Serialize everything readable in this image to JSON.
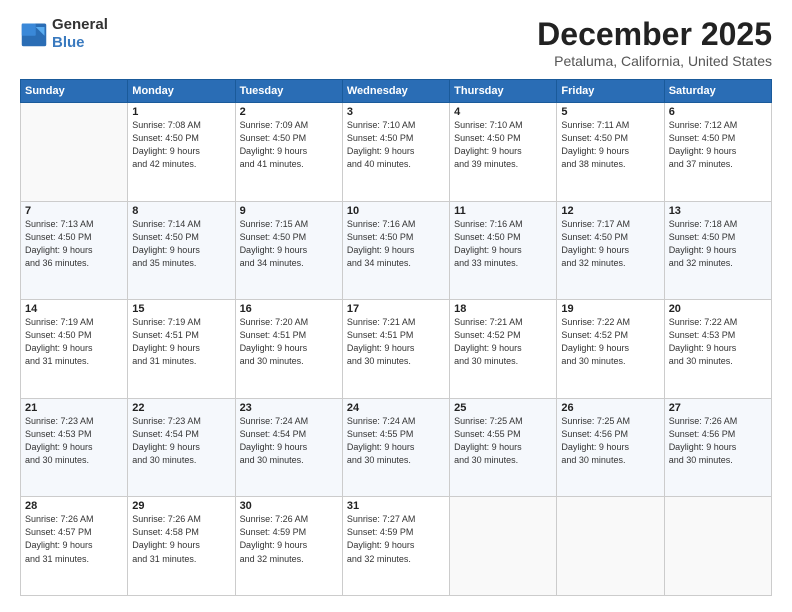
{
  "header": {
    "logo_line1": "General",
    "logo_line2": "Blue",
    "month_title": "December 2025",
    "location": "Petaluma, California, United States"
  },
  "weekdays": [
    "Sunday",
    "Monday",
    "Tuesday",
    "Wednesday",
    "Thursday",
    "Friday",
    "Saturday"
  ],
  "weeks": [
    [
      {
        "day": "",
        "sunrise": "",
        "sunset": "",
        "daylight": ""
      },
      {
        "day": "1",
        "sunrise": "7:08 AM",
        "sunset": "4:50 PM",
        "daylight": "9 hours and 42 minutes."
      },
      {
        "day": "2",
        "sunrise": "7:09 AM",
        "sunset": "4:50 PM",
        "daylight": "9 hours and 41 minutes."
      },
      {
        "day": "3",
        "sunrise": "7:10 AM",
        "sunset": "4:50 PM",
        "daylight": "9 hours and 40 minutes."
      },
      {
        "day": "4",
        "sunrise": "7:10 AM",
        "sunset": "4:50 PM",
        "daylight": "9 hours and 39 minutes."
      },
      {
        "day": "5",
        "sunrise": "7:11 AM",
        "sunset": "4:50 PM",
        "daylight": "9 hours and 38 minutes."
      },
      {
        "day": "6",
        "sunrise": "7:12 AM",
        "sunset": "4:50 PM",
        "daylight": "9 hours and 37 minutes."
      }
    ],
    [
      {
        "day": "7",
        "sunrise": "7:13 AM",
        "sunset": "4:50 PM",
        "daylight": "9 hours and 36 minutes."
      },
      {
        "day": "8",
        "sunrise": "7:14 AM",
        "sunset": "4:50 PM",
        "daylight": "9 hours and 35 minutes."
      },
      {
        "day": "9",
        "sunrise": "7:15 AM",
        "sunset": "4:50 PM",
        "daylight": "9 hours and 34 minutes."
      },
      {
        "day": "10",
        "sunrise": "7:16 AM",
        "sunset": "4:50 PM",
        "daylight": "9 hours and 34 minutes."
      },
      {
        "day": "11",
        "sunrise": "7:16 AM",
        "sunset": "4:50 PM",
        "daylight": "9 hours and 33 minutes."
      },
      {
        "day": "12",
        "sunrise": "7:17 AM",
        "sunset": "4:50 PM",
        "daylight": "9 hours and 32 minutes."
      },
      {
        "day": "13",
        "sunrise": "7:18 AM",
        "sunset": "4:50 PM",
        "daylight": "9 hours and 32 minutes."
      }
    ],
    [
      {
        "day": "14",
        "sunrise": "7:19 AM",
        "sunset": "4:50 PM",
        "daylight": "9 hours and 31 minutes."
      },
      {
        "day": "15",
        "sunrise": "7:19 AM",
        "sunset": "4:51 PM",
        "daylight": "9 hours and 31 minutes."
      },
      {
        "day": "16",
        "sunrise": "7:20 AM",
        "sunset": "4:51 PM",
        "daylight": "9 hours and 30 minutes."
      },
      {
        "day": "17",
        "sunrise": "7:21 AM",
        "sunset": "4:51 PM",
        "daylight": "9 hours and 30 minutes."
      },
      {
        "day": "18",
        "sunrise": "7:21 AM",
        "sunset": "4:52 PM",
        "daylight": "9 hours and 30 minutes."
      },
      {
        "day": "19",
        "sunrise": "7:22 AM",
        "sunset": "4:52 PM",
        "daylight": "9 hours and 30 minutes."
      },
      {
        "day": "20",
        "sunrise": "7:22 AM",
        "sunset": "4:53 PM",
        "daylight": "9 hours and 30 minutes."
      }
    ],
    [
      {
        "day": "21",
        "sunrise": "7:23 AM",
        "sunset": "4:53 PM",
        "daylight": "9 hours and 30 minutes."
      },
      {
        "day": "22",
        "sunrise": "7:23 AM",
        "sunset": "4:54 PM",
        "daylight": "9 hours and 30 minutes."
      },
      {
        "day": "23",
        "sunrise": "7:24 AM",
        "sunset": "4:54 PM",
        "daylight": "9 hours and 30 minutes."
      },
      {
        "day": "24",
        "sunrise": "7:24 AM",
        "sunset": "4:55 PM",
        "daylight": "9 hours and 30 minutes."
      },
      {
        "day": "25",
        "sunrise": "7:25 AM",
        "sunset": "4:55 PM",
        "daylight": "9 hours and 30 minutes."
      },
      {
        "day": "26",
        "sunrise": "7:25 AM",
        "sunset": "4:56 PM",
        "daylight": "9 hours and 30 minutes."
      },
      {
        "day": "27",
        "sunrise": "7:26 AM",
        "sunset": "4:56 PM",
        "daylight": "9 hours and 30 minutes."
      }
    ],
    [
      {
        "day": "28",
        "sunrise": "7:26 AM",
        "sunset": "4:57 PM",
        "daylight": "9 hours and 31 minutes."
      },
      {
        "day": "29",
        "sunrise": "7:26 AM",
        "sunset": "4:58 PM",
        "daylight": "9 hours and 31 minutes."
      },
      {
        "day": "30",
        "sunrise": "7:26 AM",
        "sunset": "4:59 PM",
        "daylight": "9 hours and 32 minutes."
      },
      {
        "day": "31",
        "sunrise": "7:27 AM",
        "sunset": "4:59 PM",
        "daylight": "9 hours and 32 minutes."
      },
      {
        "day": "",
        "sunrise": "",
        "sunset": "",
        "daylight": ""
      },
      {
        "day": "",
        "sunrise": "",
        "sunset": "",
        "daylight": ""
      },
      {
        "day": "",
        "sunrise": "",
        "sunset": "",
        "daylight": ""
      }
    ]
  ]
}
